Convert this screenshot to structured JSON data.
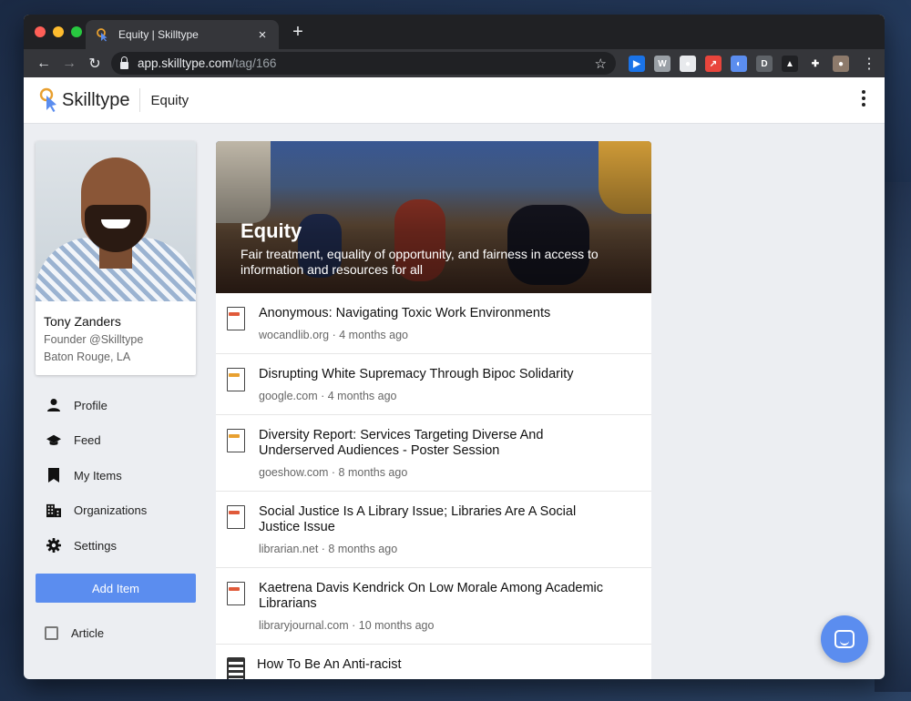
{
  "browser": {
    "tab_title": "Equity | Skilltype",
    "tab_close": "×",
    "new_tab": "+",
    "url_host": "app.skilltype.com",
    "url_path": "/tag/166",
    "back": "←",
    "forward": "→",
    "reload": "↻",
    "star": "☆",
    "menu": "⋮",
    "extensions": [
      {
        "icon": "screencast-icon",
        "color": "#1a73e8",
        "glyph": "▶"
      },
      {
        "icon": "w-icon",
        "color": "#9aa0a6",
        "glyph": "W"
      },
      {
        "icon": "circle-icon",
        "color": "#e8eaed",
        "glyph": "●"
      },
      {
        "icon": "arrow-icon",
        "color": "#e8453c",
        "glyph": "↗"
      },
      {
        "icon": "skilltype-ext-icon",
        "color": "#5b8def",
        "glyph": "◐"
      },
      {
        "icon": "d-icon",
        "color": "#5f6368",
        "glyph": "D"
      },
      {
        "icon": "cone-icon",
        "color": "#202124",
        "glyph": "▲"
      },
      {
        "icon": "puzzle-icon",
        "color": "#35363a",
        "glyph": "✚"
      },
      {
        "icon": "profile-avatar-icon",
        "color": "#8d7a6b",
        "glyph": "●"
      }
    ]
  },
  "header": {
    "brand": "Skilltype",
    "page": "Equity"
  },
  "profile": {
    "name": "Tony Zanders",
    "role": "Founder @Skilltype",
    "location": "Baton Rouge, LA"
  },
  "nav": [
    {
      "label": "Profile",
      "icon": "person-icon"
    },
    {
      "label": "Feed",
      "icon": "graduation-cap-icon"
    },
    {
      "label": "My Items",
      "icon": "bookmark-icon"
    },
    {
      "label": "Organizations",
      "icon": "building-icon"
    },
    {
      "label": "Settings",
      "icon": "gear-icon"
    }
  ],
  "add_item_label": "Add Item",
  "filter_label": "Article",
  "hero": {
    "title": "Equity",
    "description": "Fair treatment, equality of opportunity, and fairness in access to information and resources for all"
  },
  "items": [
    {
      "title": "Anonymous: Navigating Toxic Work Environments",
      "meta": "wocandlib.org · 4 months ago",
      "tag_color": "#e05a3a"
    },
    {
      "title": "Disrupting White Supremacy Through Bipoc Solidarity",
      "meta": "google.com · 4 months ago",
      "tag_color": "#e8a030"
    },
    {
      "title": "Diversity Report: Services Targeting Diverse And Underserved Audiences - Poster Session",
      "meta": "goeshow.com · 8 months ago",
      "tag_color": "#e8a030"
    },
    {
      "title": "Social Justice Is A Library Issue; Libraries Are A Social Justice Issue",
      "meta": "librarian.net · 8 months ago",
      "tag_color": "#e05a3a"
    },
    {
      "title": "Kaetrena Davis Kendrick On Low Morale Among Academic Librarians",
      "meta": "libraryjournal.com · 10 months ago",
      "tag_color": "#e05a3a"
    },
    {
      "title": "How To Be An Anti-racist",
      "meta": "",
      "tag_color": ""
    }
  ]
}
